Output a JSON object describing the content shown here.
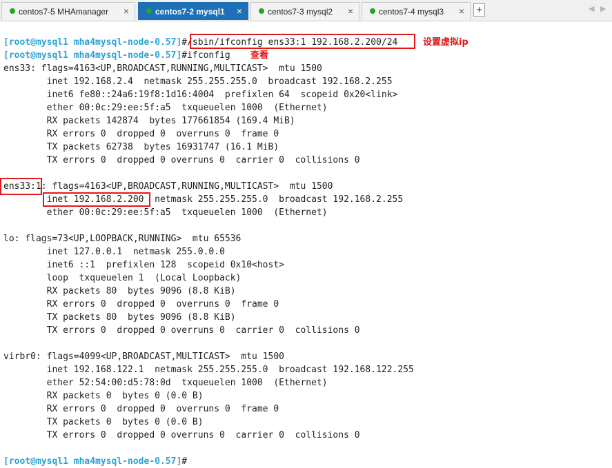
{
  "tabs": [
    {
      "label": "centos7-5 MHAmanager",
      "close": "×"
    },
    {
      "label": "centos7-2 mysql1",
      "close": "×"
    },
    {
      "label": "centos7-3 mysql2",
      "close": "×"
    },
    {
      "label": "centos7-4 mysql3",
      "close": "×"
    }
  ],
  "tab_add": "+",
  "nav": {
    "prev": "◀",
    "next": "▶"
  },
  "colors": {
    "active_tab": "#1e6fb8",
    "status_dot": "#22a722",
    "prompt": "#2ba3d6",
    "annotation": "#e01818"
  },
  "terminal": {
    "prompt": "[root@mysql1 mha4mysql-node-0.57]",
    "cmd1": "#/sbin/ifconfig ens33:1 192.168.2.200/24",
    "annot1": "设置虚拟ip",
    "cmd2": "#ifconfig",
    "annot2": "查看",
    "cmd3": "#",
    "lines": [
      "ens33: flags=4163<UP,BROADCAST,RUNNING,MULTICAST>  mtu 1500",
      "        inet 192.168.2.4  netmask 255.255.255.0  broadcast 192.168.2.255",
      "        inet6 fe80::24a6:19f8:1d16:4004  prefixlen 64  scopeid 0x20<link>",
      "        ether 00:0c:29:ee:5f:a5  txqueuelen 1000  (Ethernet)",
      "        RX packets 142874  bytes 177661854 (169.4 MiB)",
      "        RX errors 0  dropped 0  overruns 0  frame 0",
      "        TX packets 62738  bytes 16931747 (16.1 MiB)",
      "        TX errors 0  dropped 0 overruns 0  carrier 0  collisions 0",
      "",
      "ens33:1: flags=4163<UP,BROADCAST,RUNNING,MULTICAST>  mtu 1500",
      "        inet 192.168.2.200  netmask 255.255.255.0  broadcast 192.168.2.255",
      "        ether 00:0c:29:ee:5f:a5  txqueuelen 1000  (Ethernet)",
      "",
      "lo: flags=73<UP,LOOPBACK,RUNNING>  mtu 65536",
      "        inet 127.0.0.1  netmask 255.0.0.0",
      "        inet6 ::1  prefixlen 128  scopeid 0x10<host>",
      "        loop  txqueuelen 1  (Local Loopback)",
      "        RX packets 80  bytes 9096 (8.8 KiB)",
      "        RX errors 0  dropped 0  overruns 0  frame 0",
      "        TX packets 80  bytes 9096 (8.8 KiB)",
      "        TX errors 0  dropped 0 overruns 0  carrier 0  collisions 0",
      "",
      "virbr0: flags=4099<UP,BROADCAST,MULTICAST>  mtu 1500",
      "        inet 192.168.122.1  netmask 255.255.255.0  broadcast 192.168.122.255",
      "        ether 52:54:00:d5:78:0d  txqueuelen 1000  (Ethernet)",
      "        RX packets 0  bytes 0 (0.0 B)",
      "        RX errors 0  dropped 0  overruns 0  frame 0",
      "        TX packets 0  bytes 0 (0.0 B)",
      "        TX errors 0  dropped 0 overruns 0  carrier 0  collisions 0",
      ""
    ]
  }
}
